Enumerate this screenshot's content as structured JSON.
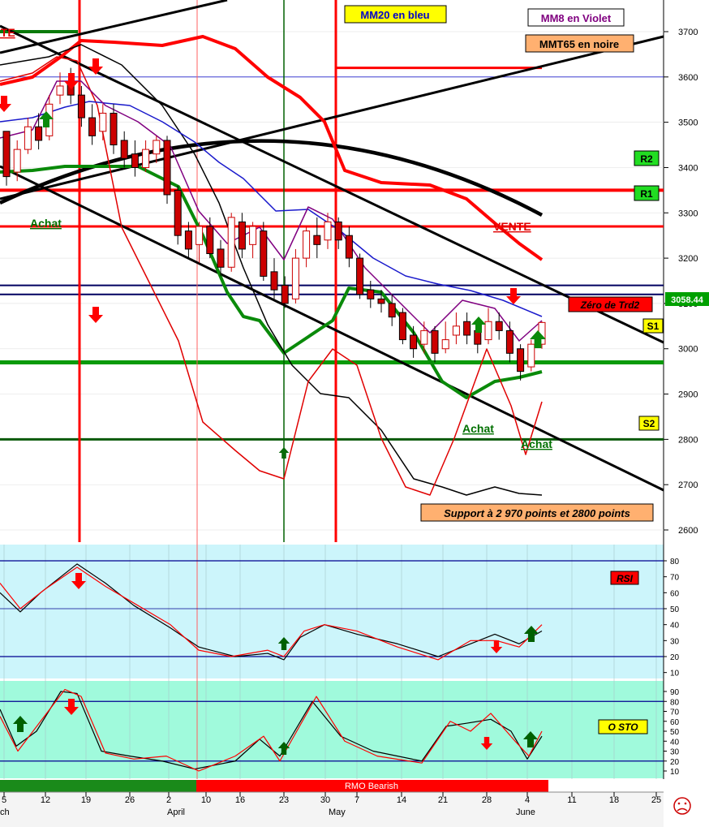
{
  "chart_data": {
    "type": "line",
    "legend": {
      "mm20": "MM20 en bleu",
      "mm8": "MM8 en Violet",
      "mmt65": "MMT65 en noire"
    },
    "annotations": {
      "vente_top": "VENTE",
      "vente_mid": "VENTE",
      "achat_left": "Achat",
      "achat_mid": "Achat",
      "achat_right": "Achat",
      "zero_trd2": "Zéro de Trd2",
      "support": "Support à 2 970 points et 2800 points",
      "rsi": "RSI",
      "osto": "O STO",
      "rmo": "RMO Bearish"
    },
    "levels": {
      "r2": {
        "label": "R2",
        "value": 3350
      },
      "r1": {
        "label": "R1",
        "value": 3270
      },
      "s1": {
        "label": "S1",
        "value": 2970
      },
      "s2": {
        "label": "S2",
        "value": 2800
      }
    },
    "last_price": {
      "label": "3058.44",
      "value": 3058.44
    },
    "y_ticks": [
      3700,
      3600,
      3500,
      3400,
      3300,
      3200,
      3100,
      3000,
      2900,
      2800,
      2700,
      2600
    ],
    "rsi_ticks": [
      80,
      70,
      60,
      50,
      40,
      30,
      20,
      10
    ],
    "sto_ticks": [
      90,
      80,
      70,
      60,
      50,
      40,
      30,
      20,
      10
    ],
    "x_ticks": [
      "5",
      "12",
      "19",
      "26",
      "2",
      "10",
      "16",
      "23",
      "30",
      "7",
      "14",
      "21",
      "28",
      "4",
      "11",
      "18",
      "25"
    ],
    "month_labels": [
      "ch",
      "April",
      "May",
      "June"
    ],
    "candles": [
      [
        3480,
        3380,
        3420,
        3360
      ],
      [
        3390,
        3440,
        3460,
        3370
      ],
      [
        3440,
        3490,
        3510,
        3430
      ],
      [
        3490,
        3460,
        3520,
        3440
      ],
      [
        3470,
        3540,
        3560,
        3460
      ],
      [
        3560,
        3580,
        3610,
        3540
      ],
      [
        3590,
        3560,
        3620,
        3540
      ],
      [
        3560,
        3510,
        3580,
        3490
      ],
      [
        3510,
        3470,
        3540,
        3450
      ],
      [
        3480,
        3520,
        3540,
        3460
      ],
      [
        3520,
        3450,
        3540,
        3430
      ],
      [
        3460,
        3420,
        3480,
        3400
      ],
      [
        3430,
        3400,
        3460,
        3380
      ],
      [
        3400,
        3440,
        3460,
        3390
      ],
      [
        3430,
        3460,
        3470,
        3410
      ],
      [
        3460,
        3340,
        3470,
        3320
      ],
      [
        3350,
        3250,
        3360,
        3230
      ],
      [
        3260,
        3220,
        3280,
        3200
      ],
      [
        3230,
        3270,
        3280,
        3190
      ],
      [
        3270,
        3210,
        3290,
        3200
      ],
      [
        3220,
        3180,
        3240,
        3160
      ],
      [
        3180,
        3290,
        3300,
        3170
      ],
      [
        3280,
        3220,
        3300,
        3200
      ],
      [
        3230,
        3270,
        3280,
        3200
      ],
      [
        3260,
        3160,
        3280,
        3150
      ],
      [
        3170,
        3130,
        3200,
        3110
      ],
      [
        3140,
        3100,
        3160,
        3090
      ],
      [
        3110,
        3200,
        3220,
        3100
      ],
      [
        3200,
        3260,
        3270,
        3180
      ],
      [
        3250,
        3230,
        3290,
        3200
      ],
      [
        3240,
        3280,
        3300,
        3220
      ],
      [
        3280,
        3240,
        3290,
        3220
      ],
      [
        3250,
        3200,
        3270,
        3180
      ],
      [
        3200,
        3120,
        3210,
        3110
      ],
      [
        3130,
        3110,
        3150,
        3090
      ],
      [
        3110,
        3100,
        3130,
        3080
      ],
      [
        3100,
        3070,
        3120,
        3050
      ],
      [
        3080,
        3020,
        3090,
        3010
      ],
      [
        3030,
        3000,
        3050,
        2980
      ],
      [
        3010,
        3040,
        3060,
        2990
      ],
      [
        3040,
        2990,
        3050,
        2970
      ],
      [
        3000,
        3020,
        3060,
        2990
      ],
      [
        3030,
        3050,
        3080,
        3010
      ],
      [
        3060,
        3030,
        3080,
        3010
      ],
      [
        3040,
        3010,
        3060,
        2990
      ],
      [
        3020,
        3060,
        3090,
        3010
      ],
      [
        3060,
        3040,
        3080,
        3020
      ],
      [
        3040,
        2990,
        3060,
        2970
      ],
      [
        3000,
        2950,
        3010,
        2930
      ],
      [
        2960,
        3010,
        3020,
        2950
      ],
      [
        3010,
        3058,
        3060,
        3000
      ]
    ]
  }
}
